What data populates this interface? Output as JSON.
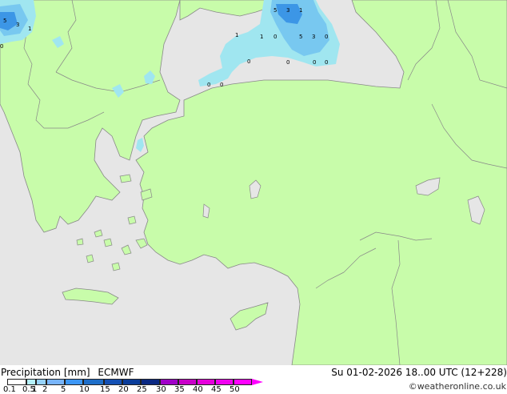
{
  "title": "Precipitation [mm]",
  "model": "ECMWF",
  "valid_time": "Su 01-02-2026 18..00 UTC (12+228)",
  "credit": "©weatheronline.co.uk",
  "legend": {
    "ticks": [
      "0.1",
      "0.5",
      "1",
      "2",
      "5",
      "10",
      "15",
      "20",
      "25",
      "30",
      "35",
      "40",
      "45",
      "50"
    ],
    "colors": [
      "#ffffff",
      "#b4f0fa",
      "#96d2fa",
      "#78b4fa",
      "#3c96f5",
      "#1e6ec8",
      "#1450b4",
      "#0a3c9a",
      "#0a2882",
      "#a000c8",
      "#c800c8",
      "#e600dc",
      "#f000f0",
      "#ff00ff"
    ]
  },
  "colors": {
    "land": "#c8fcaa",
    "sea": "#e6e6e6",
    "border": "#888888",
    "light_precip": "#a0e6f0",
    "mid_precip": "#78c8f0",
    "heavy_precip": "#3c96e6"
  },
  "map_labels": [
    "5",
    "3",
    "1",
    "0",
    "1",
    "1",
    "0",
    "5",
    "3",
    "0",
    "0",
    "0",
    "0",
    "0",
    "0",
    "0",
    "5",
    "3",
    "1"
  ]
}
